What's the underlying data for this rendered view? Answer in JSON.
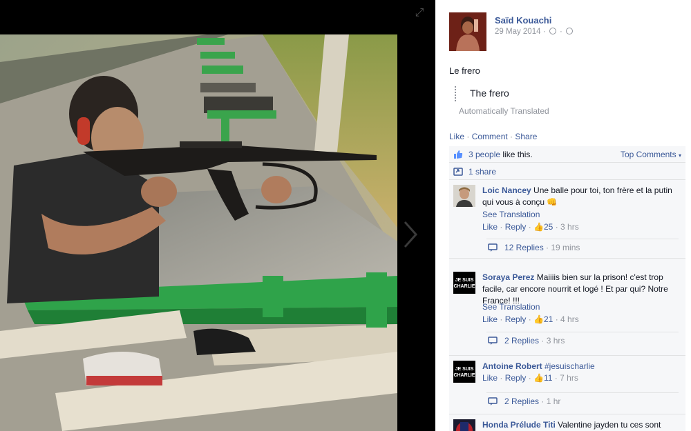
{
  "post": {
    "author": "Saïd Kouachi",
    "date": "29 May 2014",
    "caption": "Le frero",
    "translation": "The frero",
    "translation_note": "Automatically Translated",
    "actions": {
      "like": "Like",
      "comment": "Comment",
      "share": "Share"
    },
    "likes_count_link": "3 people",
    "likes_suffix": " like this.",
    "top_comments": "Top Comments",
    "shares": "1 share"
  },
  "comments": [
    {
      "name": "Loic Nancey",
      "text": " Une balle pour toi, ton frère et la putin qui vous à conçu",
      "see_translation": "See Translation",
      "like": "Like",
      "reply": "Reply",
      "likes": "25",
      "time": "3 hrs",
      "replies": "12 Replies",
      "replies_time": "19 mins"
    },
    {
      "name": "Soraya Perez",
      "text": " Maiiiis bien sur la prison! c'est trop facile, car encore nourrit et logé ! Et par qui? Notre France! !!!",
      "see_translation": "See Translation",
      "like": "Like",
      "reply": "Reply",
      "likes": "21",
      "time": "4 hrs",
      "replies": "2 Replies",
      "replies_time": "3 hrs",
      "avatar_text": "JE SUIS CHARLIE"
    },
    {
      "name": "Antoine Robert",
      "text": " #jesuischarlie",
      "like": "Like",
      "reply": "Reply",
      "likes": "11",
      "time": "7 hrs",
      "replies": "2 Replies",
      "replies_time": "1 hr",
      "avatar_text": "JE SUIS CHARLIE"
    },
    {
      "name": "Honda Prélude Titi",
      "text": " Valentine jayden tu ces sont"
    }
  ],
  "colors": {
    "link": "#3b5998",
    "muted": "#90949c",
    "feedback_bg": "#f6f7f9"
  },
  "icons": {
    "expand": "expand-icon",
    "next": "chevron-right-icon",
    "like": "thumbs-up-icon",
    "share": "share-icon",
    "reply": "reply-icon",
    "clock": "clock-icon",
    "globe": "globe-icon"
  }
}
